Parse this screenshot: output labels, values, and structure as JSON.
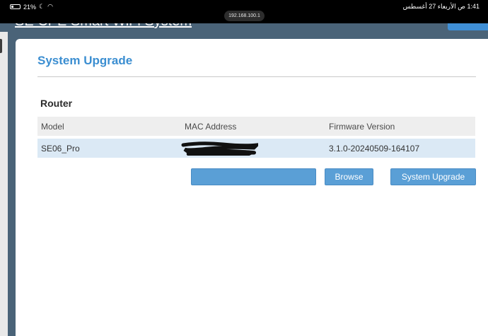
{
  "status_bar": {
    "battery": "21%",
    "datetime": "1:41 ص  الأربعاء 27 أغسطس",
    "url": "192.168.100.1"
  },
  "header": {
    "site_title": "SE CPE Smart WiFi System"
  },
  "page": {
    "title": "System Upgrade",
    "section": "Router"
  },
  "table": {
    "columns": [
      "Model",
      "MAC Address",
      "Firmware Version"
    ],
    "rows": [
      {
        "model": "SE06_Pro",
        "mac": "",
        "firmware": "3.1.0-20240509-164107"
      }
    ]
  },
  "actions": {
    "file_value": "",
    "browse_label": "Browse",
    "upgrade_label": "System Upgrade"
  },
  "colors": {
    "accent": "#3b8ed1",
    "button": "#5a9fd6",
    "row_highlight": "#dbe9f5",
    "backdrop": "#4a6378"
  }
}
